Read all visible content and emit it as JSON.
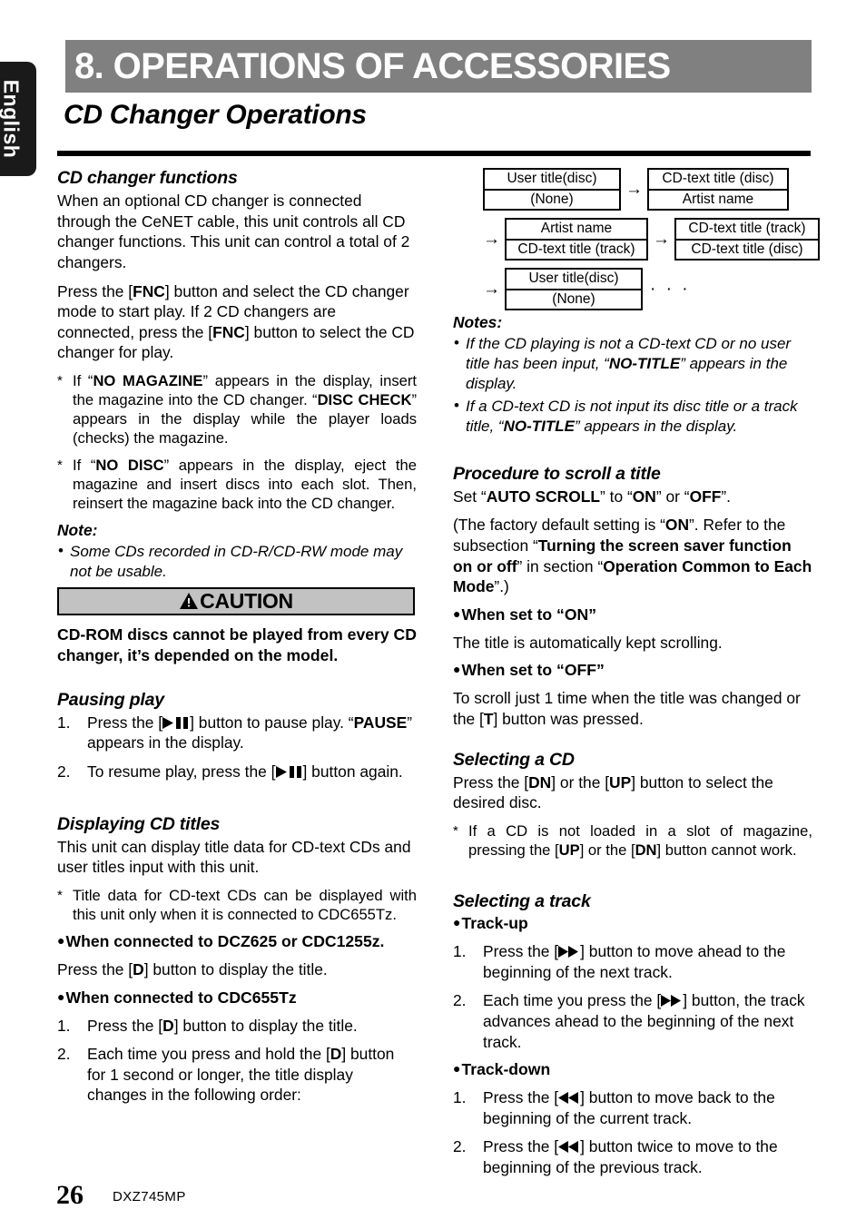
{
  "language_tab": {
    "label": "English"
  },
  "chapter": {
    "banner_title": "8. OPERATIONS OF ACCESSORIES",
    "banner_color": "#808080"
  },
  "section": {
    "title": "CD Changer Operations"
  },
  "left_column": {
    "cd_changer_functions": {
      "heading": "CD changer functions",
      "para1": "When an optional CD changer is connected through the CeNET cable, this unit controls all CD changer functions. This unit can control a total of 2 changers.",
      "para2_a": "Press the [",
      "para2_b": "FNC",
      "para2_c": "] button and select the CD changer mode to start play. If 2 CD changers are connected, press the [",
      "para2_d": "FNC",
      "para2_e": "] button to select the CD changer for play.",
      "note1_a": "If “",
      "note1_b": "NO MAGAZINE",
      "note1_c": "” appears in the display, insert the magazine into the CD changer. “",
      "note1_d": "DISC CHECK",
      "note1_e": "” appears in the display while the player loads (checks) the magazine.",
      "note2_a": "If “",
      "note2_b": "NO DISC",
      "note2_c": "” appears in the display, eject the magazine and insert discs into each slot. Then, reinsert the magazine back into the CD changer.",
      "note_label": "Note:",
      "note_bullet": "Some CDs recorded in CD-R/CD-RW mode may not be usable."
    },
    "caution": {
      "label": "CAUTION",
      "body": "CD-ROM discs cannot be played from every CD changer, it’s depended on the model."
    },
    "pausing_play": {
      "heading": "Pausing play",
      "item1_a": "Press the [",
      "item1_b": "] button to pause play. “",
      "item1_c": "PAUSE",
      "item1_d": "” appears in the display.",
      "item2_a": "To resume play, press the [",
      "item2_b": "] button again.",
      "marker1": "1.",
      "marker2": "2."
    },
    "displaying_cd_titles": {
      "heading": "Displaying CD titles",
      "para1": "This unit can display title data for CD-text CDs and user titles input with this unit.",
      "note1": "Title data for CD-text CDs can be displayed with this unit only when it is connected to CDC655Tz.",
      "dot1": "When connected to DCZ625 or CDC1255z.",
      "para2_a": "Press the [",
      "para2_b": "D",
      "para2_c": "] button to display the title.",
      "dot2": "When connected to CDC655Tz",
      "item1_a": "Press the [",
      "item1_b": "D",
      "item1_c": "] button to display the title.",
      "item2_a": "Each time you press and hold the [",
      "item2_b": "D",
      "item2_c": "] button for 1 second or longer, the title display changes in the following order:",
      "marker1": "1.",
      "marker2": "2."
    }
  },
  "right_column": {
    "title_order_diagram": {
      "arrow": "→",
      "ellipsis": "· · ·",
      "boxes": [
        {
          "top": "User title(disc)",
          "bottom": "(None)"
        },
        {
          "top": "CD-text title (disc)",
          "bottom": "Artist name"
        },
        {
          "top": "Artist name",
          "bottom": "CD-text title (track)"
        },
        {
          "top": "CD-text title (track)",
          "bottom": "CD-text title (disc)"
        },
        {
          "top": "User title(disc)",
          "bottom": "(None)"
        }
      ]
    },
    "notes": {
      "label": "Notes:",
      "note1_a": "If the CD playing is not a CD-text CD or no user title has been input, “",
      "note1_b": "NO-TITLE",
      "note1_c": "” appears in the display.",
      "note2_a": "If a CD-text CD is not input its disc title or a track title, “",
      "note2_b": "NO-TITLE",
      "note2_c": "” appears in the display."
    },
    "procedure_scroll_title": {
      "heading": "Procedure to scroll a title",
      "para1_a": "Set “",
      "para1_b": "AUTO SCROLL",
      "para1_c": "” to “",
      "para1_d": "ON",
      "para1_e": "” or “",
      "para1_f": "OFF",
      "para1_g": "”.",
      "para2_a": "(The factory default setting is “",
      "para2_b": "ON",
      "para2_c": "”. Refer to the subsection “",
      "para2_d": "Turning the screen saver function on or off",
      "para2_e": "” in section “",
      "para2_f": "Operation Common to Each Mode",
      "para2_g": "”.)",
      "dot_on": "When set to “ON”",
      "on_body": "The title is automatically kept scrolling.",
      "dot_off": "When set to “OFF”",
      "off_body_a": "To scroll just 1 time when the title was changed or the [",
      "off_body_b": "T",
      "off_body_c": "] button was pressed."
    },
    "selecting_a_cd": {
      "heading": "Selecting a CD",
      "para_a": "Press the [",
      "para_b": "DN",
      "para_c": "] or the [",
      "para_d": "UP",
      "para_e": "] button to select the desired disc.",
      "note_a": "If a CD is not loaded in a slot of magazine, pressing the [",
      "note_b": "UP",
      "note_c": "] or the [",
      "note_d": "DN",
      "note_e": "] button cannot work."
    },
    "selecting_a_track": {
      "heading": "Selecting a track",
      "dot_up": "Track-up",
      "up_item1_a": "Press the [",
      "up_item1_b": "] button to move ahead to the beginning of the next track.",
      "up_item2_a": "Each time you press the [",
      "up_item2_b": "] button, the track advances ahead to the beginning of the next track.",
      "dot_down": "Track-down",
      "down_item1_a": "Press the [",
      "down_item1_b": "] button to move back to the beginning of the current track.",
      "down_item2_a": "Press the [",
      "down_item2_b": "] button twice to move to the beginning of the previous track.",
      "marker1": "1.",
      "marker2": "2."
    }
  },
  "footer": {
    "page_number": "26",
    "model": "DXZ745MP"
  }
}
